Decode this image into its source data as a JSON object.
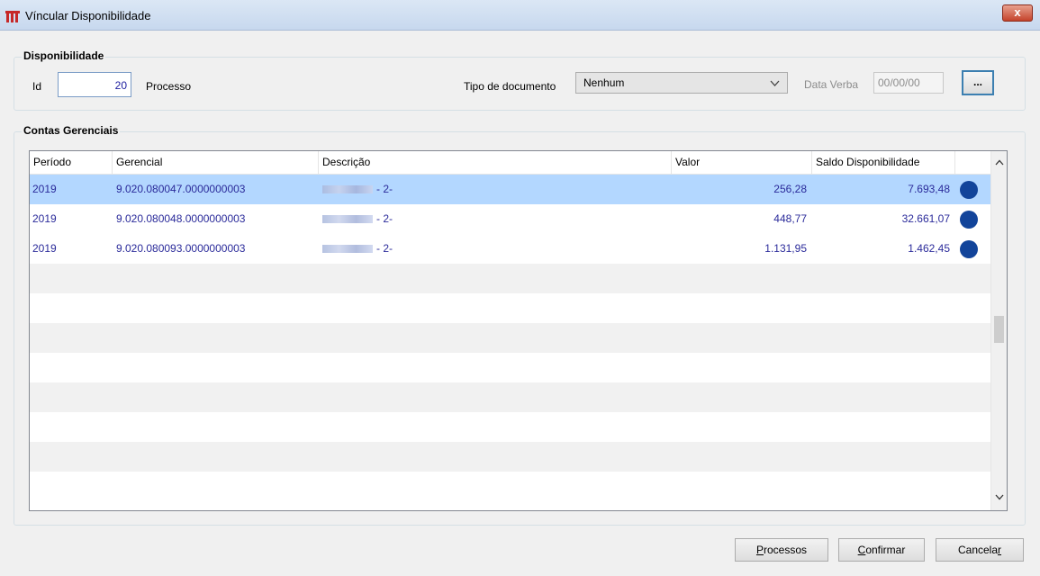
{
  "window": {
    "title": "Víncular Disponibilidade",
    "close_label": "x"
  },
  "disponibilidade": {
    "group_label": "Disponibilidade",
    "id_label": "Id",
    "id_value": "20",
    "processo_label": "Processo",
    "tipo_documento_label": "Tipo de documento",
    "tipo_documento_value": "Nenhum",
    "data_verba_label": "Data Verba",
    "data_verba_value": "00/00/00",
    "ellipsis_label": "..."
  },
  "contas": {
    "group_label": "Contas Gerenciais",
    "columns": [
      "Período",
      "Gerencial",
      "Descrição",
      "Valor",
      "Saldo Disponibilidade"
    ],
    "rows": [
      {
        "periodo": "2019",
        "gerencial": "9.020.080047.0000000003",
        "descricao": "- 2-",
        "valor": "256,28",
        "saldo": "7.693,48"
      },
      {
        "periodo": "2019",
        "gerencial": "9.020.080048.0000000003",
        "descricao": "- 2-",
        "valor": "448,77",
        "saldo": "32.661,07"
      },
      {
        "periodo": "2019",
        "gerencial": "9.020.080093.0000000003",
        "descricao": "- 2-",
        "valor": "1.131,95",
        "saldo": "1.462,45"
      }
    ],
    "selected_row_color": "#b3d7ff",
    "status_dot_color": "#12449a"
  },
  "buttons": {
    "processos": {
      "mnemonic": "P",
      "rest": "rocessos"
    },
    "confirmar": {
      "mnemonic": "C",
      "rest": "onfirmar"
    },
    "cancelar": {
      "prefix": "Cancela",
      "mnemonic": "r"
    }
  },
  "icons": {
    "app": "app-logo-icon",
    "dropdown": "chevron-down-icon",
    "scroll_up": "chevron-up-icon",
    "scroll_down": "chevron-down-icon"
  }
}
